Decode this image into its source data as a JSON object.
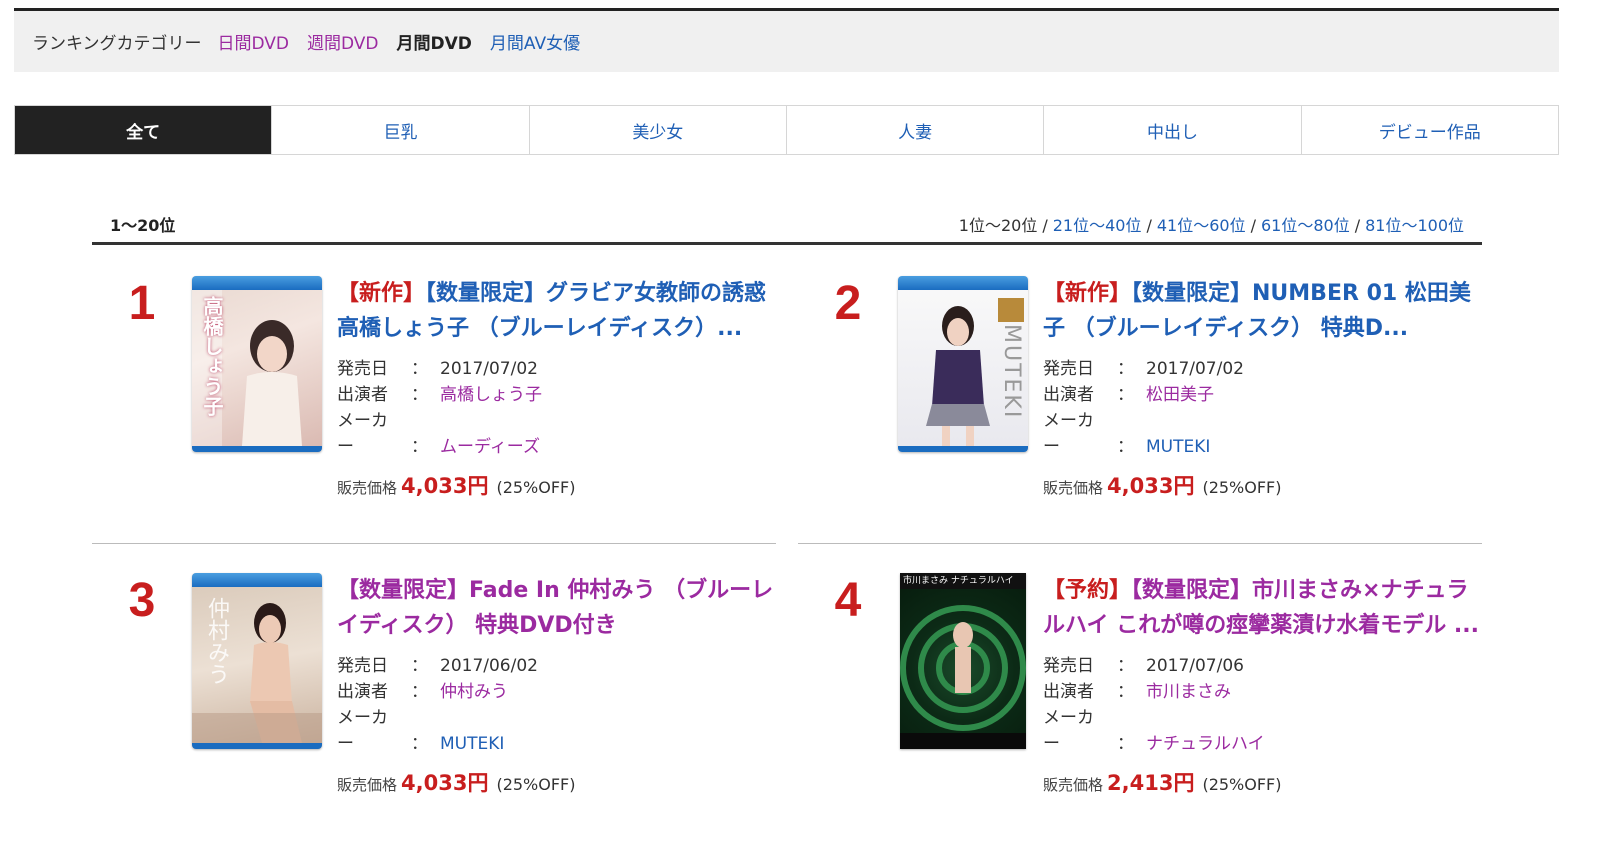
{
  "category_bar": {
    "label": "ランキングカテゴリー",
    "links": [
      "日間DVD",
      "週間DVD",
      "月間DVD",
      "月間AV女優"
    ]
  },
  "tabs": [
    "全て",
    "巨乳",
    "美少女",
    "人妻",
    "中出し",
    "デビュー作品"
  ],
  "range": {
    "current": "1～20位",
    "pager": [
      "1位～20位",
      "21位～40位",
      "41位～60位",
      "61位～80位",
      "81位～100位"
    ]
  },
  "labels": {
    "release": "発売日",
    "performer": "出演者",
    "maker": "メーカー",
    "colon": "：",
    "price_label": "販売価格"
  },
  "items": [
    {
      "rank": "1",
      "tag": "【新作】",
      "title": "【数量限定】グラビア女教師の誘惑 高橋しょう子 （ブルーレイディスク）...",
      "release": "2017/07/02",
      "performer": "高橋しょう子",
      "maker": "ムーディーズ",
      "price": "4,033円",
      "discount": "(25%OFF)",
      "cover_text": "高橋しょう子"
    },
    {
      "rank": "2",
      "tag": "【新作】",
      "title": "【数量限定】NUMBER 01 松田美子 （ブルーレイディスク） 特典D...",
      "release": "2017/07/02",
      "performer": "松田美子",
      "maker": "MUTEKI",
      "price": "4,033円",
      "discount": "(25%OFF)",
      "cover_text": "MUTEKI"
    },
    {
      "rank": "3",
      "tag": "",
      "title": "【数量限定】Fade In 仲村みう （ブルーレイディスク） 特典DVD付き",
      "release": "2017/06/02",
      "performer": "仲村みう",
      "maker": "MUTEKI",
      "price": "4,033円",
      "discount": "(25%OFF)",
      "cover_text": "仲村みう"
    },
    {
      "rank": "4",
      "tag": "【予約】",
      "title": "【数量限定】市川まさみ×ナチュラルハイ これが噂の痙攣薬漬け水着モデル ...",
      "release": "2017/07/06",
      "performer": "市川まさみ",
      "maker": "ナチュラルハイ",
      "price": "2,413円",
      "discount": "(25%OFF)",
      "cover_text": "市川まさみ ナチュラルハイ"
    }
  ]
}
